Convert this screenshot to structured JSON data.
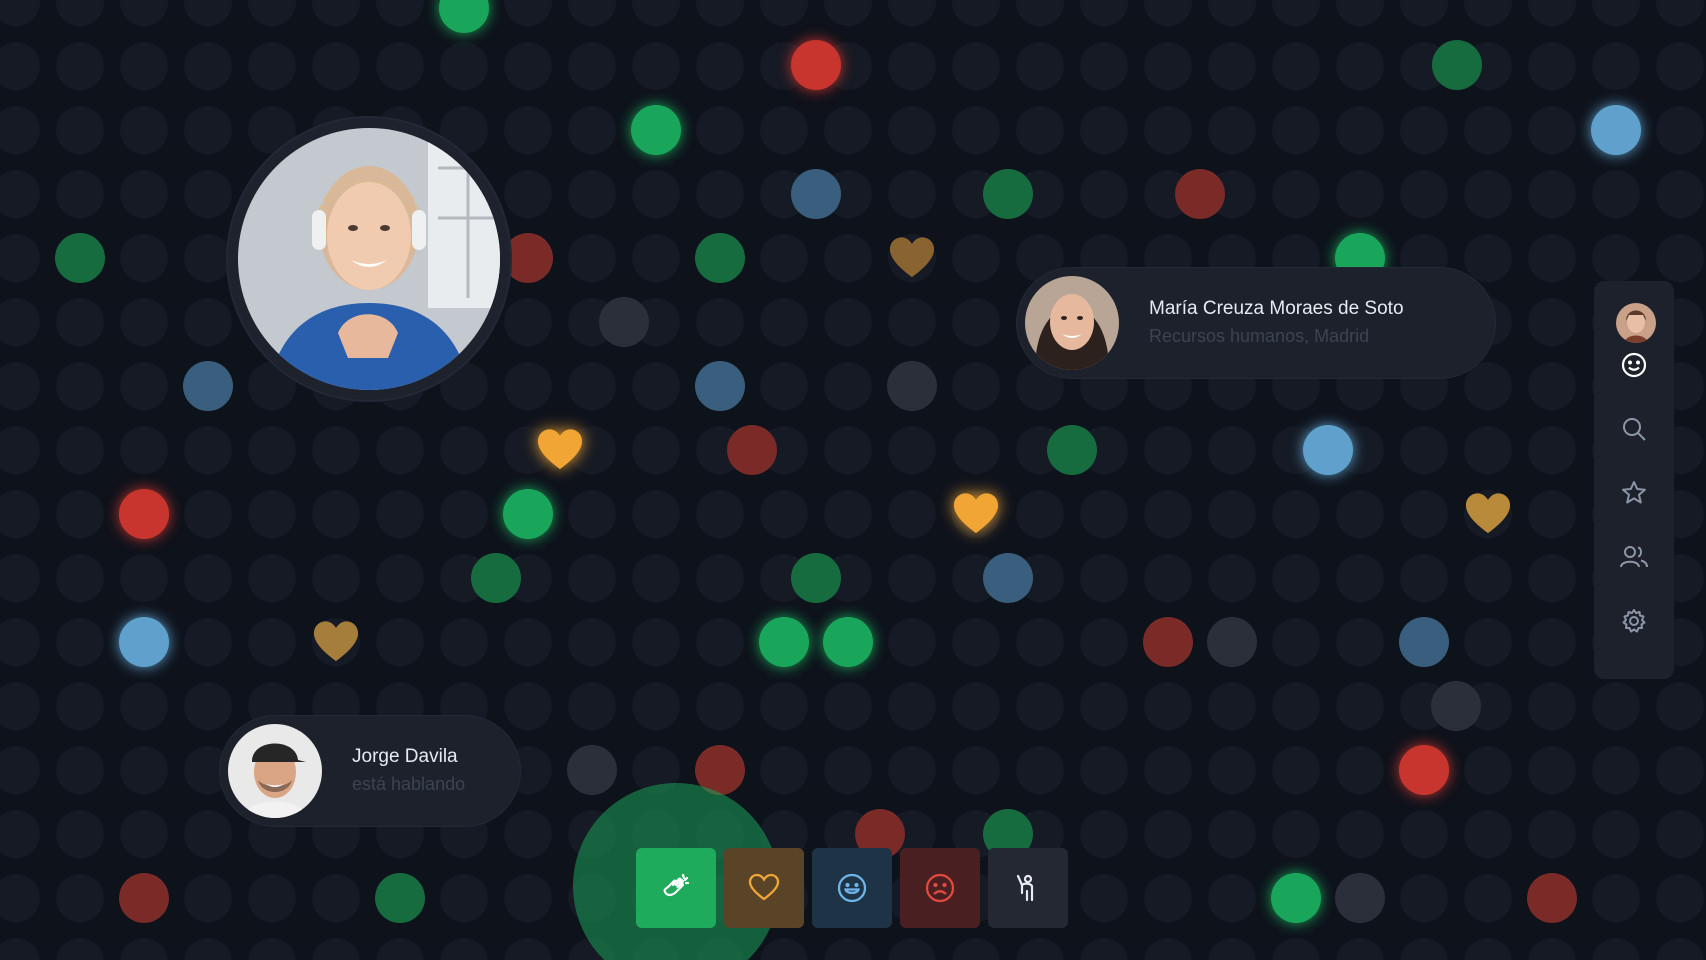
{
  "participants": [
    {
      "name": "María Creuza Moraes de Soto",
      "subtitle": "Recursos humanos, Madrid"
    },
    {
      "name": "Jorge Davila",
      "subtitle": "está hablando"
    }
  ],
  "sidebar": {
    "items": [
      {
        "icon": "user-avatar"
      },
      {
        "icon": "smiley-icon"
      },
      {
        "icon": "search-icon"
      },
      {
        "icon": "star-icon"
      },
      {
        "icon": "users-icon"
      },
      {
        "icon": "gear-icon"
      }
    ]
  },
  "reaction_bar": {
    "buttons": [
      {
        "icon": "clap-icon",
        "active": true
      },
      {
        "icon": "heart-icon",
        "active": false
      },
      {
        "icon": "happy-face-icon",
        "active": false
      },
      {
        "icon": "sad-face-icon",
        "active": false
      },
      {
        "icon": "raise-hand-icon",
        "active": false
      }
    ]
  },
  "colors": {
    "background": "#0e121b",
    "panel": "#1c212c",
    "green": "#1aa65a",
    "red": "#c7352e",
    "blue": "#5fa0cc",
    "gold": "#f0a535",
    "reaction_active": "#1fab5c",
    "reaction_heart": "#5a4428",
    "reaction_happy": "#1e3346",
    "reaction_sad": "#4a1f21",
    "reaction_hand": "#232833"
  }
}
